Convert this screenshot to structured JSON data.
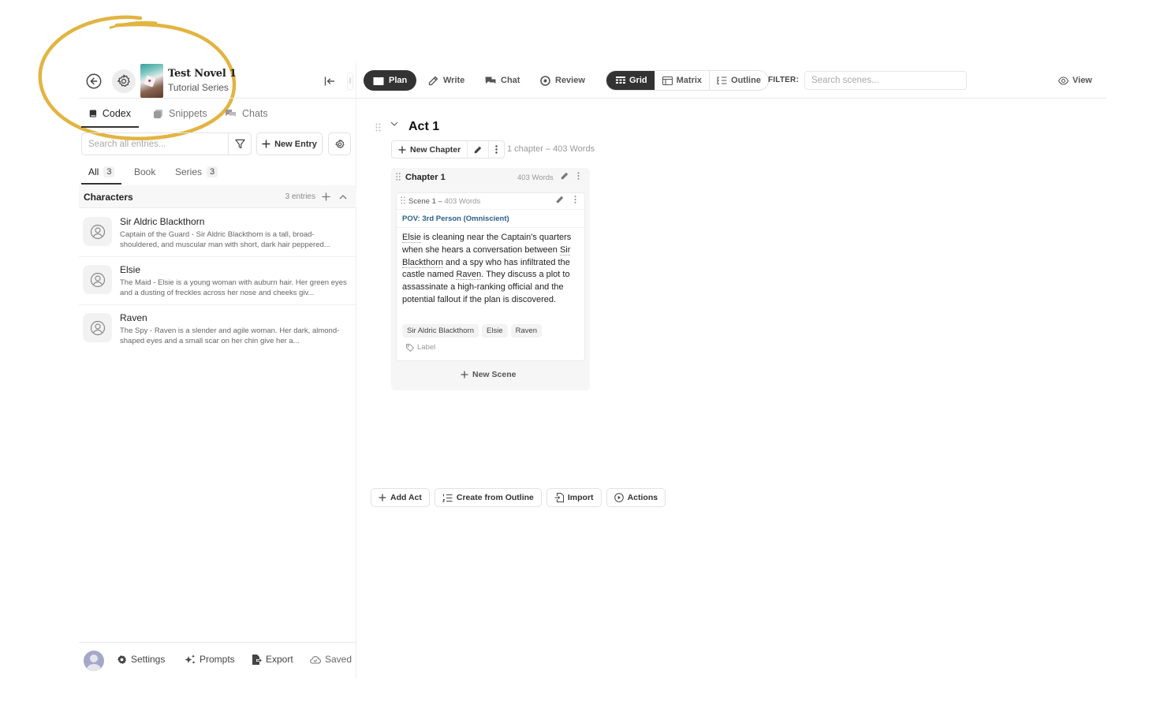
{
  "book": {
    "title": "Test Novel 1",
    "series": "Tutorial Series"
  },
  "sidebar": {
    "tabs": [
      {
        "label": "Codex",
        "icon": "book-icon",
        "active": true
      },
      {
        "label": "Snippets",
        "icon": "snippets-icon",
        "active": false
      },
      {
        "label": "Chats",
        "icon": "chat-bubbles-icon",
        "active": false
      }
    ],
    "search": {
      "placeholder": "Search all entries...",
      "value": ""
    },
    "new_entry_label": "New Entry",
    "filter_tabs": [
      {
        "label": "All",
        "count": "3",
        "active": true
      },
      {
        "label": "Book",
        "count": "",
        "active": false
      },
      {
        "label": "Series",
        "count": "3",
        "active": false
      }
    ],
    "category": {
      "title": "Characters",
      "count_label": "3 entries"
    },
    "entries": [
      {
        "name": "Sir Aldric Blackthorn",
        "description": "Captain of the Guard - Sir Aldric Blackthorn is a tall, broad-shouldered, and muscular man with short, dark hair peppered..."
      },
      {
        "name": "Elsie",
        "description": "The Maid - Elsie is a young woman with auburn hair. Her green eyes and a dusting of freckles across her nose and cheeks giv..."
      },
      {
        "name": "Raven",
        "description": "The Spy - Raven is a slender and agile woman. Her dark, almond-shaped eyes and a small scar on her chin give her a..."
      }
    ],
    "footer": {
      "settings": "Settings",
      "prompts": "Prompts",
      "export": "Export",
      "saved": "Saved"
    }
  },
  "topbar": {
    "modes": [
      {
        "label": "Plan",
        "active": true
      },
      {
        "label": "Write",
        "active": false
      },
      {
        "label": "Chat",
        "active": false
      },
      {
        "label": "Review",
        "active": false
      }
    ],
    "views": [
      {
        "label": "Grid",
        "active": true
      },
      {
        "label": "Matrix",
        "active": false
      },
      {
        "label": "Outline",
        "active": false
      }
    ],
    "filter_label": "FILTER:",
    "scene_search_placeholder": "Search scenes...",
    "view_label": "View"
  },
  "act": {
    "title": "Act 1",
    "new_chapter_label": "New Chapter",
    "meta": "1 chapter  –  403 Words",
    "chapter": {
      "title": "Chapter 1",
      "words": "403 Words",
      "scene": {
        "title": "Scene 1",
        "words": "403 Words",
        "pov": "POV: 3rd Person (Omniscient)",
        "summary": {
          "p1": "Elsie",
          "p2": " is cleaning near the Captain's quarters when she hears a conversation between ",
          "p3": "Sir Blackthorn",
          "p4": " and a spy who has infiltrated the castle named ",
          "p5": "Raven",
          "p6": ". They discuss a plot to assassinate a high-ranking official and the potential fallout if the plan is discovered."
        },
        "tags": [
          "Sir Aldric Blackthorn",
          "Elsie",
          "Raven"
        ],
        "label_placeholder": "Label"
      },
      "new_scene_label": "New Scene"
    }
  },
  "bottom_actions": {
    "add_act": "Add Act",
    "create_from_outline": "Create from Outline",
    "import": "Import",
    "actions": "Actions"
  },
  "colors": {
    "annotation": "#E2B441",
    "active_dark": "#333333",
    "pov_blue": "#2B5E8A"
  }
}
